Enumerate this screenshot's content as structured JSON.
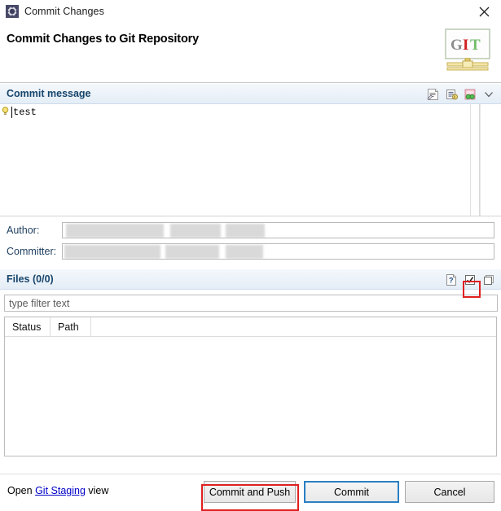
{
  "window": {
    "title": "Commit Changes",
    "icon": "commit-gear-icon",
    "close_label": "✕"
  },
  "banner": {
    "heading": "Commit Changes to Git Repository",
    "logo": {
      "name": "git-logo",
      "letters": [
        {
          "char": "G",
          "color": "#8c8c8c"
        },
        {
          "char": "I",
          "color": "#d02020"
        },
        {
          "char": "T",
          "color": "#74bd6a"
        }
      ]
    }
  },
  "commit_message": {
    "section_title": "Commit message",
    "value": "test",
    "gutter_icon": "lightbulb-quickfix-icon",
    "tools": [
      {
        "name": "insert-signed-off-by-icon",
        "tooltip": "Add Signed-off-by"
      },
      {
        "name": "insert-change-id-icon",
        "tooltip": "Add Change-Id"
      },
      {
        "name": "amend-previous-commit-icon",
        "tooltip": "Amend Previous Commit"
      },
      {
        "name": "chevron-down-icon",
        "tooltip": "More"
      }
    ]
  },
  "identity": {
    "author": {
      "label": "Author:",
      "value": ""
    },
    "committer": {
      "label": "Committer:",
      "value": ""
    }
  },
  "files": {
    "section_title": "Files",
    "count_label": "(0/0)",
    "filter_placeholder": "type filter text",
    "filter_value": "",
    "tools": [
      {
        "name": "help-icon",
        "tooltip": "Help",
        "state": "normal"
      },
      {
        "name": "select-all-checkbox-icon",
        "tooltip": "Select All",
        "state": "checked"
      },
      {
        "name": "deselect-all-checkbox-icon",
        "tooltip": "Deselect All",
        "state": "unchecked"
      }
    ],
    "columns": [
      "Status",
      "Path"
    ],
    "rows": []
  },
  "footer": {
    "open_prefix": "Open ",
    "link_label": "Git Staging",
    "open_suffix": " view",
    "buttons": [
      {
        "name": "commit-and-push-button",
        "label": "Commit and Push",
        "state": "annotated"
      },
      {
        "name": "commit-button",
        "label": "Commit",
        "state": "default-focused"
      },
      {
        "name": "cancel-button",
        "label": "Cancel",
        "state": "normal"
      }
    ]
  },
  "annotations": {
    "highlight_color": "#e02020",
    "targets": [
      "select-all-checkbox-icon",
      "commit-and-push-button"
    ]
  }
}
